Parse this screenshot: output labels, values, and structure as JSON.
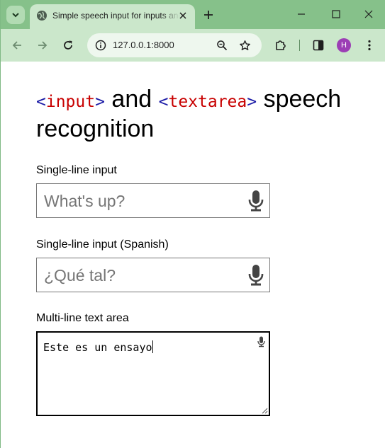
{
  "browser": {
    "tab_title": "Simple speech input for inputs and textareas",
    "url": "127.0.0.1:8000",
    "profile_initial": "H"
  },
  "page": {
    "heading": {
      "tag1": "input",
      "and": "and",
      "tag2": "textarea",
      "rest": "speech recognition"
    },
    "fields": [
      {
        "label": "Single-line input",
        "placeholder": "What's up?",
        "value": ""
      },
      {
        "label": "Single-line input (Spanish)",
        "placeholder": "¿Qué tal?",
        "value": ""
      }
    ],
    "textarea": {
      "label": "Multi-line text area",
      "value": "Este es un ensayo"
    }
  },
  "colors": {
    "titlebar": "#86c18a",
    "toolbar": "#cbe7cb",
    "tag_name": "#c80000",
    "angle_bracket": "#1a1aa6",
    "avatar": "#9c3eb5"
  }
}
